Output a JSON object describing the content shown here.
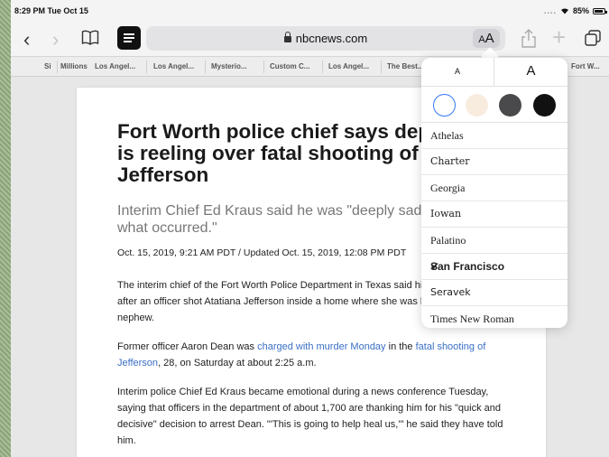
{
  "status_bar": {
    "time": "8:29 PM  Tue Oct 15",
    "dots": "....",
    "battery": "85%"
  },
  "toolbar": {
    "url": "nbcnews.com",
    "text_size_small": "A",
    "text_size_large": "A"
  },
  "bookmarks": [
    "Si",
    "Millions",
    "Los Angel...",
    "Los Angel...",
    "Mysterio...",
    "Custom C...",
    "Los Angel...",
    "The Best...",
    "Fort W..."
  ],
  "article": {
    "headline": "Fort Worth police chief says department is reeling over fatal shooting of Atatiana Jefferson",
    "subhead": "Interim Chief Ed Kraus said he was \"deeply saddened by what occurred.\"",
    "dateline": "Oct. 15, 2019, 9:21 AM PDT / Updated Oct. 15, 2019, 12:08 PM PDT",
    "p1": "The interim chief of the Fort Worth Police Department in Texas said his agency is reeling after an officer shot Atatiana Jefferson inside a home where she was babysitting her nephew.",
    "p2_a": "Former officer Aaron Dean was ",
    "p2_link1": "charged with murder Monday",
    "p2_b": " in the ",
    "p2_link2": "fatal shooting of Jefferson",
    "p2_c": ", 28, on Saturday at about 2:25 a.m.",
    "p3": "Interim police Chief Ed Kraus became emotional during a news conference Tuesday, saying that officers in the department of about 1,700 are thanking him for his \"quick and decisive\" decision to arrest Dean. \"'This is going to help heal us,'\" he said they have told him."
  },
  "reader_popover": {
    "smaller_label": "A",
    "larger_label": "A",
    "themes": [
      {
        "name": "white",
        "color": "#ffffff"
      },
      {
        "name": "sepia",
        "color": "#f8ecde"
      },
      {
        "name": "gray",
        "color": "#4a4a4c"
      },
      {
        "name": "black",
        "color": "#111111"
      }
    ],
    "fonts": [
      "Athelas",
      "Charter",
      "Georgia",
      "Iowan",
      "Palatino",
      "San Francisco",
      "Seravek",
      "Times New Roman"
    ],
    "selected_font": "San Francisco",
    "accent_color": "#3478f6"
  }
}
